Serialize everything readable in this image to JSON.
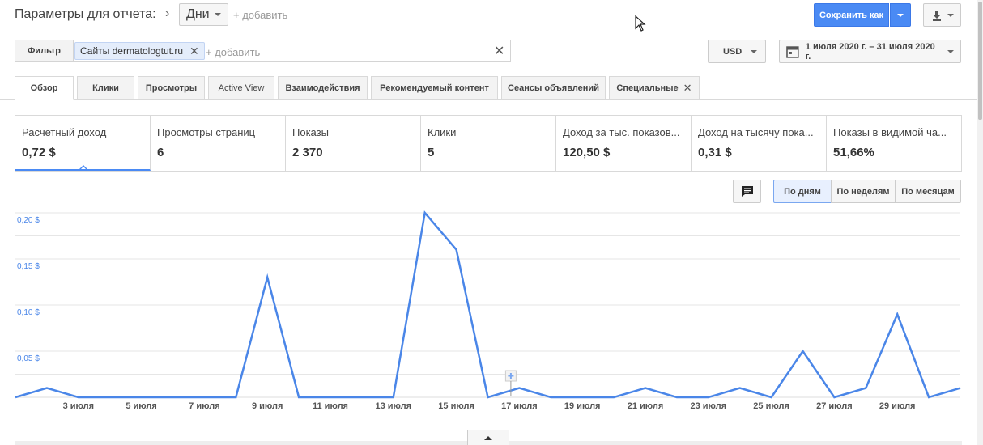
{
  "header": {
    "params_title": "Параметры для отчета:",
    "dimension": "Дни",
    "add_label": "+ добавить",
    "save_label": "Сохранить как"
  },
  "filter": {
    "button_label": "Фильтр",
    "chip_label": "Сайты dermatologtut.ru",
    "add_placeholder": "+ добавить",
    "currency": "USD",
    "date_range": "1 июля 2020 г. – 31 июля 2020 г."
  },
  "tabs": [
    {
      "label": "Обзор"
    },
    {
      "label": "Клики"
    },
    {
      "label": "Просмотры"
    },
    {
      "label": "Active View"
    },
    {
      "label": "Взаимодействия"
    },
    {
      "label": "Рекомендуемый контент"
    },
    {
      "label": "Сеансы объявлений"
    },
    {
      "label": "Специальные"
    }
  ],
  "metrics": [
    {
      "label": "Расчетный доход",
      "value": "0,72 $"
    },
    {
      "label": "Просмотры страниц",
      "value": "6"
    },
    {
      "label": "Показы",
      "value": "2 370"
    },
    {
      "label": "Клики",
      "value": "5"
    },
    {
      "label": "Доход за тыс. показов...",
      "value": "120,50 $"
    },
    {
      "label": "Доход на тысячу пока...",
      "value": "0,31 $"
    },
    {
      "label": "Показы в видимой ча...",
      "value": "51,66%"
    }
  ],
  "granularity": {
    "day": "По дням",
    "week": "По неделям",
    "month": "По месяцам"
  },
  "colors": {
    "accent": "#4a8af4",
    "line": "#4a86e8"
  },
  "chart_data": {
    "type": "line",
    "x": [
      "1 июля",
      "2 июля",
      "3 июля",
      "4 июля",
      "5 июля",
      "6 июля",
      "7 июля",
      "8 июля",
      "9 июля",
      "10 июля",
      "11 июля",
      "12 июля",
      "13 июля",
      "14 июля",
      "15 июля",
      "16 июля",
      "17 июля",
      "18 июля",
      "19 июля",
      "20 июля",
      "21 июля",
      "22 июля",
      "23 июля",
      "24 июля",
      "25 июля",
      "26 июля",
      "27 июля",
      "28 июля",
      "29 июля",
      "30 июля",
      "31 июля"
    ],
    "series": [
      {
        "values": [
          0,
          0.01,
          0,
          0,
          0,
          0,
          0,
          0,
          0.13,
          0,
          0,
          0,
          0,
          0.2,
          0.16,
          0,
          0.01,
          0,
          0,
          0,
          0.01,
          0,
          0,
          0.01,
          0,
          0.05,
          0,
          0.01,
          0.09,
          0,
          0.01
        ]
      }
    ],
    "x_tick_labels": [
      "3 июля",
      "5 июля",
      "7 июля",
      "9 июля",
      "11 июля",
      "13 июля",
      "15 июля",
      "17 июля",
      "19 июля",
      "21 июля",
      "23 июля",
      "25 июля",
      "27 июля",
      "29 июля"
    ],
    "y_tick_labels": [
      "0,20 $",
      "0,15 $",
      "0,10 $",
      "0,05 $"
    ],
    "y_ticks": [
      0.2,
      0.15,
      0.1,
      0.05
    ],
    "ylim": [
      0,
      0.2
    ],
    "grid": true
  }
}
